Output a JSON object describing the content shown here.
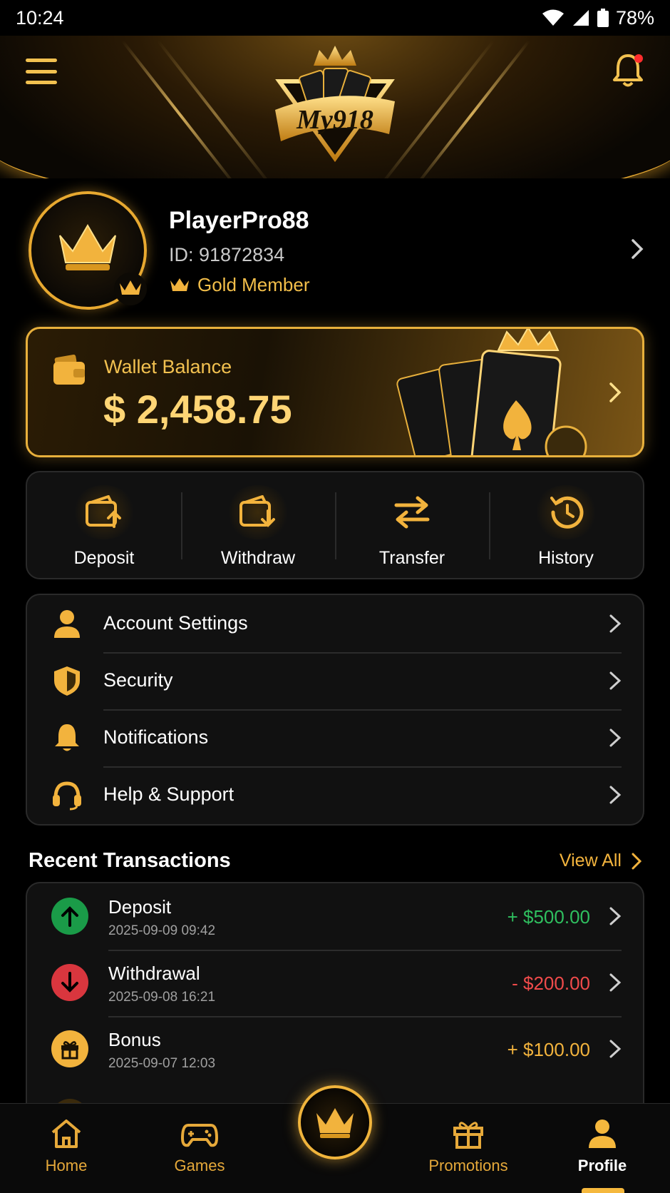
{
  "status_bar": {
    "time": "10:24",
    "battery": "78%"
  },
  "header": {
    "logo_text": "My918"
  },
  "profile": {
    "username": "PlayerPro88",
    "user_id": "ID: 91872834",
    "membership": "Gold Member"
  },
  "wallet": {
    "label": "Wallet Balance",
    "amount": "$ 2,458.75"
  },
  "quick_actions": [
    {
      "label": "Deposit",
      "icon": "wallet-in-icon"
    },
    {
      "label": "Withdraw",
      "icon": "wallet-out-icon"
    },
    {
      "label": "Transfer",
      "icon": "transfer-arrows-icon"
    },
    {
      "label": "History",
      "icon": "history-clock-icon"
    }
  ],
  "settings": [
    {
      "label": "Account Settings",
      "icon": "user-icon"
    },
    {
      "label": "Security",
      "icon": "shield-icon"
    },
    {
      "label": "Notifications",
      "icon": "bell-icon"
    },
    {
      "label": "Help & Support",
      "icon": "headset-icon"
    }
  ],
  "transactions": {
    "title": "Recent Transactions",
    "view_all": "View All",
    "items": [
      {
        "name": "Deposit",
        "date": "2025-09-09 09:42",
        "amount": "+ $500.00",
        "icon": "arrow-up-icon",
        "color": "#2fbf5f"
      },
      {
        "name": "Withdrawal",
        "date": "2025-09-08 16:21",
        "amount": "- $200.00",
        "icon": "arrow-down-icon",
        "color": "#f04b4b"
      },
      {
        "name": "Bonus",
        "date": "2025-09-07 12:03",
        "amount": "+ $100.00",
        "icon": "gift-icon",
        "color": "#f2b33d"
      }
    ]
  },
  "bottom_nav": [
    {
      "label": "Home",
      "icon": "home-icon"
    },
    {
      "label": "Games",
      "icon": "gamepad-icon"
    },
    {
      "label": "Promotions",
      "icon": "gift-icon"
    },
    {
      "label": "Profile",
      "icon": "user-icon",
      "active": true
    }
  ],
  "colors": {
    "accent": "#f2b33d",
    "background": "#000000",
    "card": "#111111"
  }
}
